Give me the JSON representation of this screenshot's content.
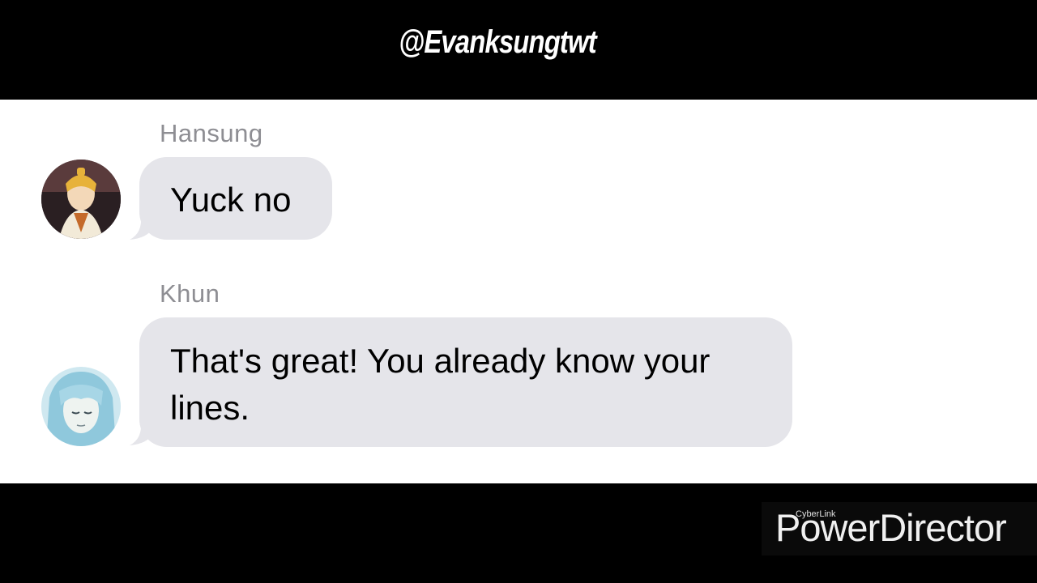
{
  "header": {
    "handle": "@Evanksungtwt"
  },
  "messages": [
    {
      "sender": "Hansung",
      "text": "Yuck no",
      "avatar": "hansung-avatar"
    },
    {
      "sender": "Khun",
      "text": "That's great! You already know your lines.",
      "avatar": "khun-avatar"
    }
  ],
  "watermark": {
    "brand_small": "CyberLink",
    "brand_large": "PowerDirector"
  },
  "colors": {
    "bubble": "#e5e5ea",
    "sender_name": "#8e8e93",
    "panel": "#ffffff",
    "letterbox": "#000000"
  }
}
